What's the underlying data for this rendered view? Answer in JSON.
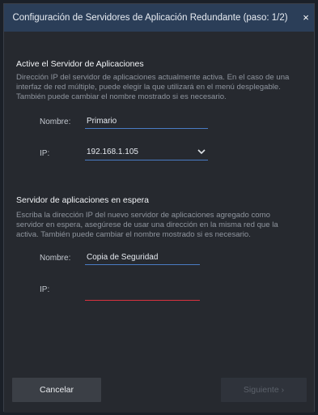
{
  "dialog": {
    "title": "Configuración de Servidores de Aplicación Redundante (paso: 1/2)",
    "close_glyph": "×"
  },
  "active_server": {
    "heading": "Active el Servidor de Aplicaciones",
    "description": "Dirección IP del servidor de aplicaciones actualmente activa. En el caso de una interfaz de red múltiple, puede elegir la que utilizará en el menú desplegable. También puede cambiar el nombre mostrado si es necesario.",
    "name_label": "Nombre:",
    "name_value": "Primario",
    "ip_label": "IP:",
    "ip_value": "192.168.1.105"
  },
  "standby_server": {
    "heading": "Servidor de aplicaciones en espera",
    "description": "Escriba la dirección IP del nuevo servidor de aplicaciones agregado como servidor en espera, asegúrese de usar una dirección en la misma red que la activa. También puede cambiar el nombre mostrado si es necesario.",
    "name_label": "Nombre:",
    "name_value": "Copia de Seguridad",
    "ip_label": "IP:",
    "ip_value": ""
  },
  "footer": {
    "cancel_label": "Cancelar",
    "next_label": "Siguiente ›"
  },
  "colors": {
    "titlebar": "#2b3e58",
    "background": "#26292f",
    "accent_underline": "#4a7bc3",
    "error_underline": "#d9333f"
  },
  "icons": {
    "close": "close-icon",
    "dropdown": "chevron-down-icon"
  }
}
